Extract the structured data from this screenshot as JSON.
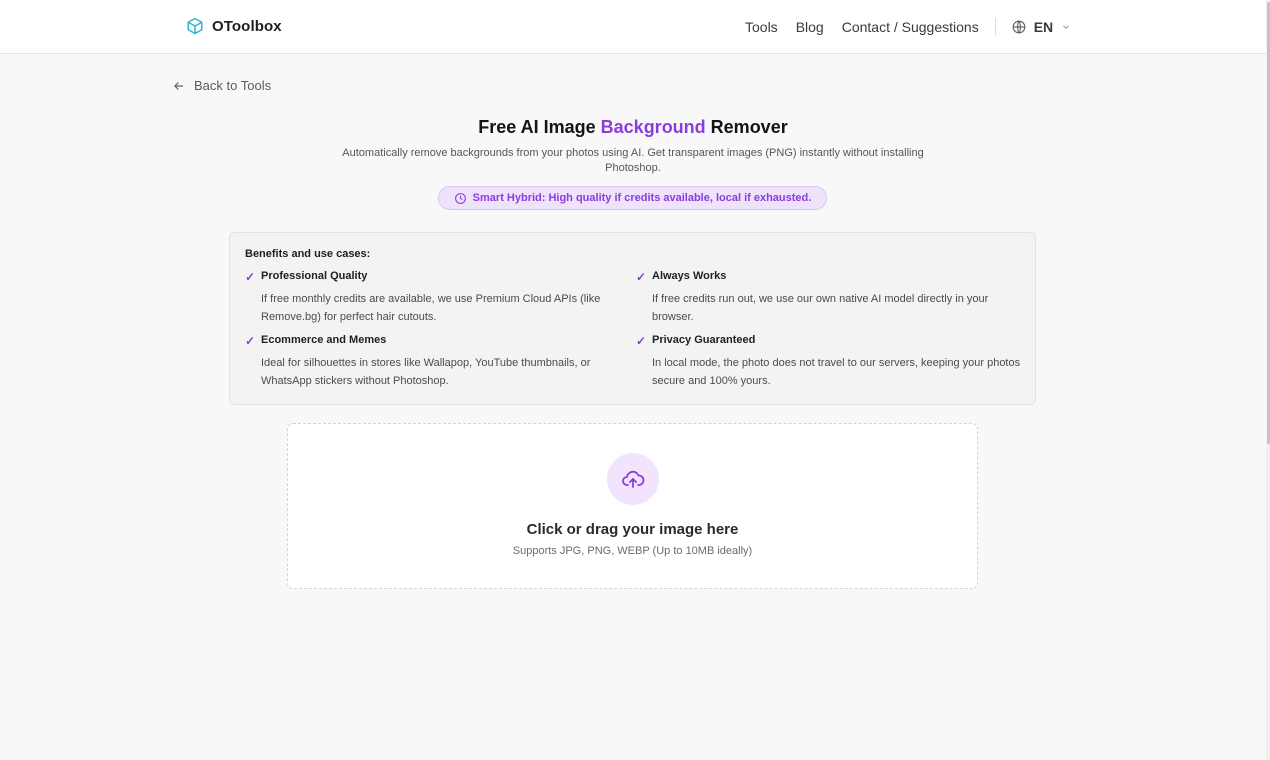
{
  "header": {
    "brand": "OToolbox",
    "nav": [
      "Tools",
      "Blog",
      "Contact / Suggestions"
    ],
    "language": "EN"
  },
  "back_link": "Back to Tools",
  "hero": {
    "title_pre": "Free AI Image ",
    "title_accent": "Background",
    "title_post": " Remover",
    "subtitle": "Automatically remove backgrounds from your photos using AI. Get transparent images (PNG) instantly without installing Photoshop.",
    "badge": "Smart Hybrid: High quality if credits available, local if exhausted."
  },
  "benefits": {
    "heading": "Benefits and use cases:",
    "items": [
      {
        "title": "Professional Quality",
        "desc": "If free monthly credits are available, we use Premium Cloud APIs (like Remove.bg) for perfect hair cutouts."
      },
      {
        "title": "Always Works",
        "desc": "If free credits run out, we use our own native AI model directly in your browser."
      },
      {
        "title": "Ecommerce and Memes",
        "desc": "Ideal for silhouettes in stores like Wallapop, YouTube thumbnails, or WhatsApp stickers without Photoshop."
      },
      {
        "title": "Privacy Guaranteed",
        "desc": "In local mode, the photo does not travel to our servers, keeping your photos secure and 100% yours."
      }
    ]
  },
  "upload": {
    "title": "Click or drag your image here",
    "subtitle": "Supports JPG, PNG, WEBP (Up to 10MB ideally)"
  },
  "colors": {
    "accent": "#8b3ddc",
    "brand_icon": "#2bb6c9",
    "badge_bg": "#efe2fb"
  },
  "icons": {
    "brand": "cube-icon",
    "language": "globe-icon",
    "dropdown": "chevron-down-icon",
    "back": "arrow-left-icon",
    "badge": "clock-icon",
    "check": "check-icon",
    "upload": "cloud-upload-icon"
  }
}
